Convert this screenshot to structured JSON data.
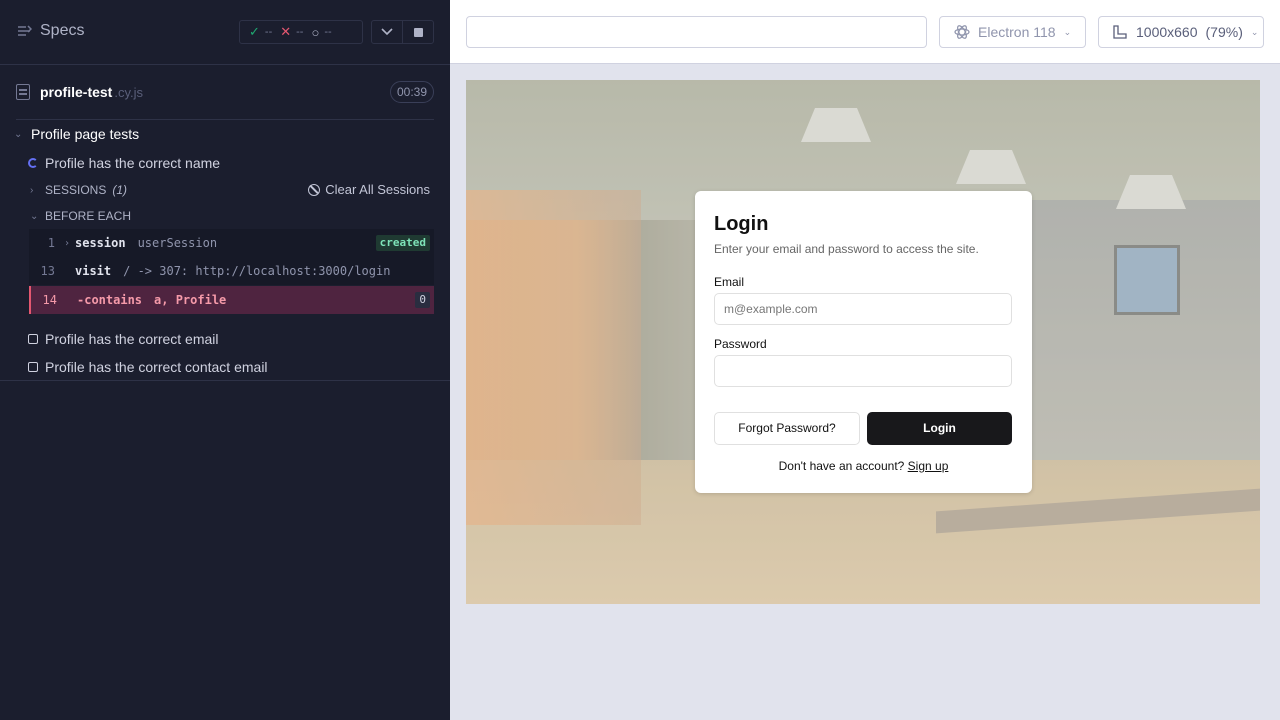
{
  "reporter": {
    "specs_label": "Specs",
    "stats": {
      "passed": "--",
      "failed": "--",
      "pending": "--"
    },
    "spec": {
      "name": "profile-test",
      "ext": ".cy.js",
      "duration": "00:39"
    },
    "suite_title": "Profile page tests",
    "tests": {
      "running": "Profile has the correct name",
      "pending1": "Profile has the correct email",
      "pending2": "Profile has the correct contact email"
    },
    "sessions_label": "SESSIONS",
    "sessions_count": "(1)",
    "clear_sessions": "Clear All Sessions",
    "before_each": "BEFORE EACH",
    "commands": [
      {
        "num": "1",
        "name": "session",
        "message": "userSession",
        "badge": "created"
      },
      {
        "num": "13",
        "name": "visit",
        "message": "/ -> 307: http://localhost:3000/login"
      },
      {
        "num": "14",
        "name": "-contains",
        "message": "a, Profile",
        "badge": "0"
      }
    ]
  },
  "aut": {
    "browser": "Electron 118",
    "viewport": "1000x660",
    "zoom": "(79%)",
    "login": {
      "title": "Login",
      "subtitle": "Enter your email and password to access the site.",
      "email_label": "Email",
      "email_placeholder": "m@example.com",
      "password_label": "Password",
      "forgot_button": "Forgot Password?",
      "login_button": "Login",
      "no_account": "Don't have an account?",
      "signup_link": "Sign up"
    }
  },
  "colors": {
    "passed": "#1fa971",
    "failed": "#e45770",
    "running": "#6470f3",
    "created": "#7ee3b8"
  }
}
